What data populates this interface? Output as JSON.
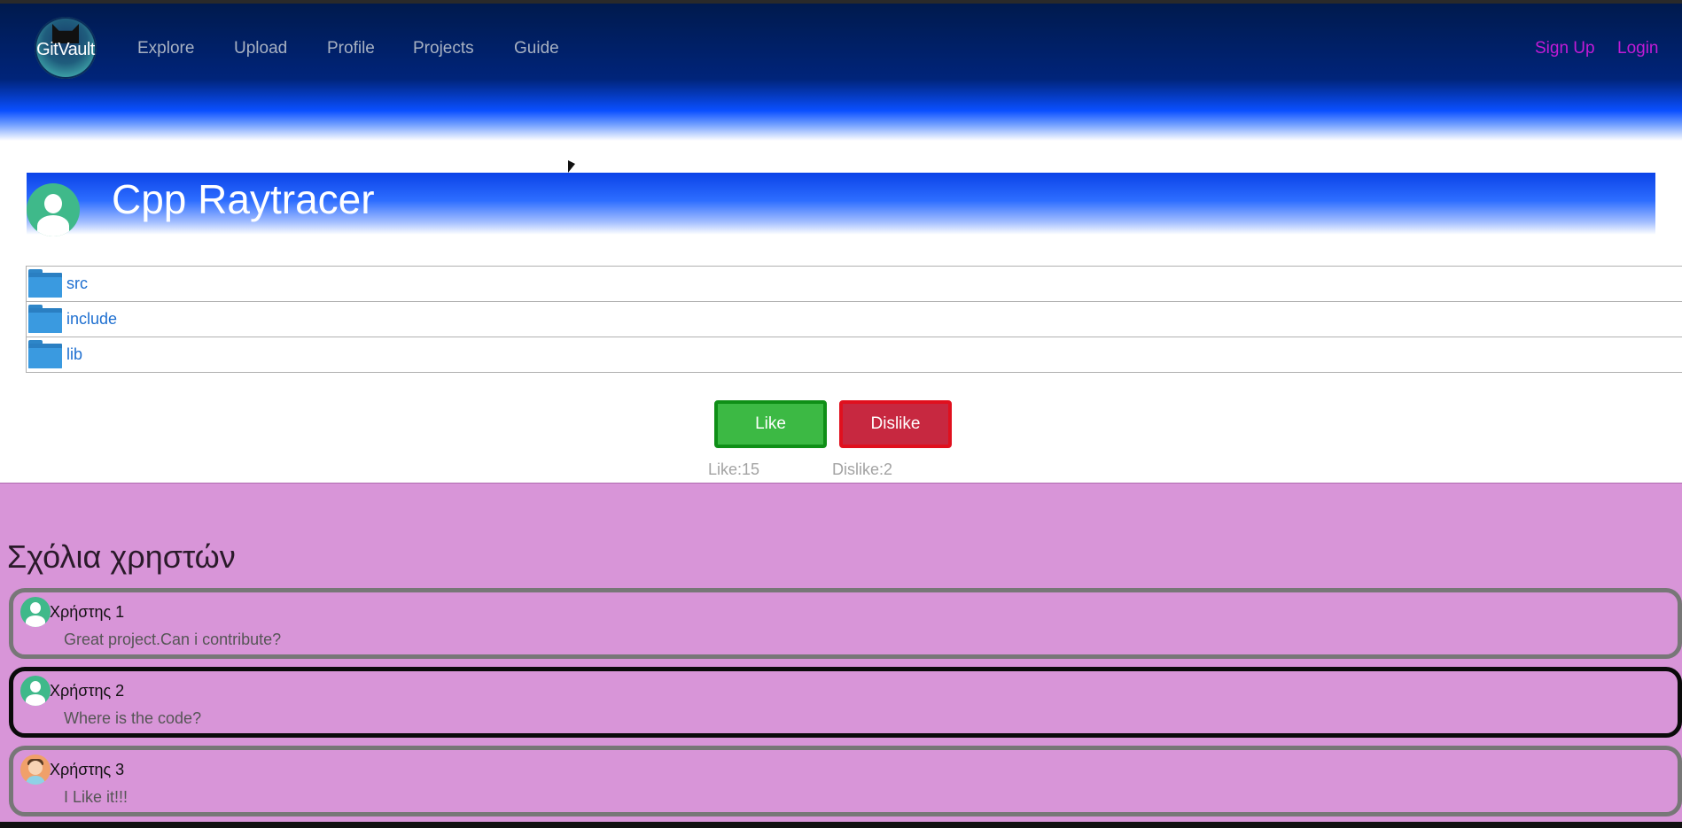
{
  "navbar": {
    "logo_text": "GitVault",
    "links": [
      "Explore",
      "Upload",
      "Profile",
      "Projects",
      "Guide"
    ],
    "sign_up": "Sign Up",
    "login": "Login"
  },
  "project": {
    "title": "Cpp Raytracer",
    "files": [
      "src",
      "include",
      "lib"
    ]
  },
  "votes": {
    "like_label": "Like",
    "dislike_label": "Dislike",
    "like_count": "Like:15",
    "dislike_count": "Dislike:2"
  },
  "comments": {
    "title": "Σχόλια χρηστών",
    "items": [
      {
        "user": "Χρήστης 1",
        "text": "Great project.Can i contribute?"
      },
      {
        "user": "Χρήστης 2",
        "text": "Where is the code?"
      },
      {
        "user": "Χρήστης 3",
        "text": "I Like it!!!"
      }
    ]
  },
  "colors": {
    "nav_link": "#a7b1c2",
    "auth_link": "#c21bd6",
    "like_button": "#3cb944",
    "dislike_button": "#c72840",
    "comments_background": "#d895d8"
  }
}
